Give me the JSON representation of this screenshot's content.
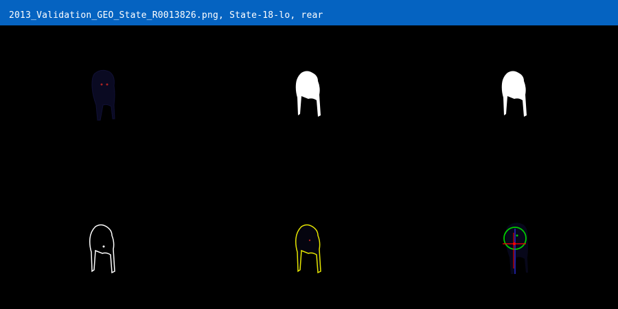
{
  "window": {
    "title": "2013_Validation_GEO_State_R0013826.png, State-18-lo, rear"
  },
  "colors": {
    "titlebar": "#0563c1",
    "background": "#000000",
    "mask": "#ffffff",
    "contour": "#ffffff",
    "overlay_contour": "#e6e600",
    "fit_circle": "#00cc00",
    "axis_vertical": "#3333ff",
    "axis_marker": "#ff0000"
  },
  "panels": [
    {
      "name": "original-image-panel",
      "kind": "original"
    },
    {
      "name": "binary-mask-panel",
      "kind": "mask"
    },
    {
      "name": "cleaned-mask-panel",
      "kind": "mask"
    },
    {
      "name": "contour-panel",
      "kind": "contour"
    },
    {
      "name": "contour-overlay-panel",
      "kind": "overlay"
    },
    {
      "name": "circle-fit-panel",
      "kind": "fit"
    }
  ]
}
